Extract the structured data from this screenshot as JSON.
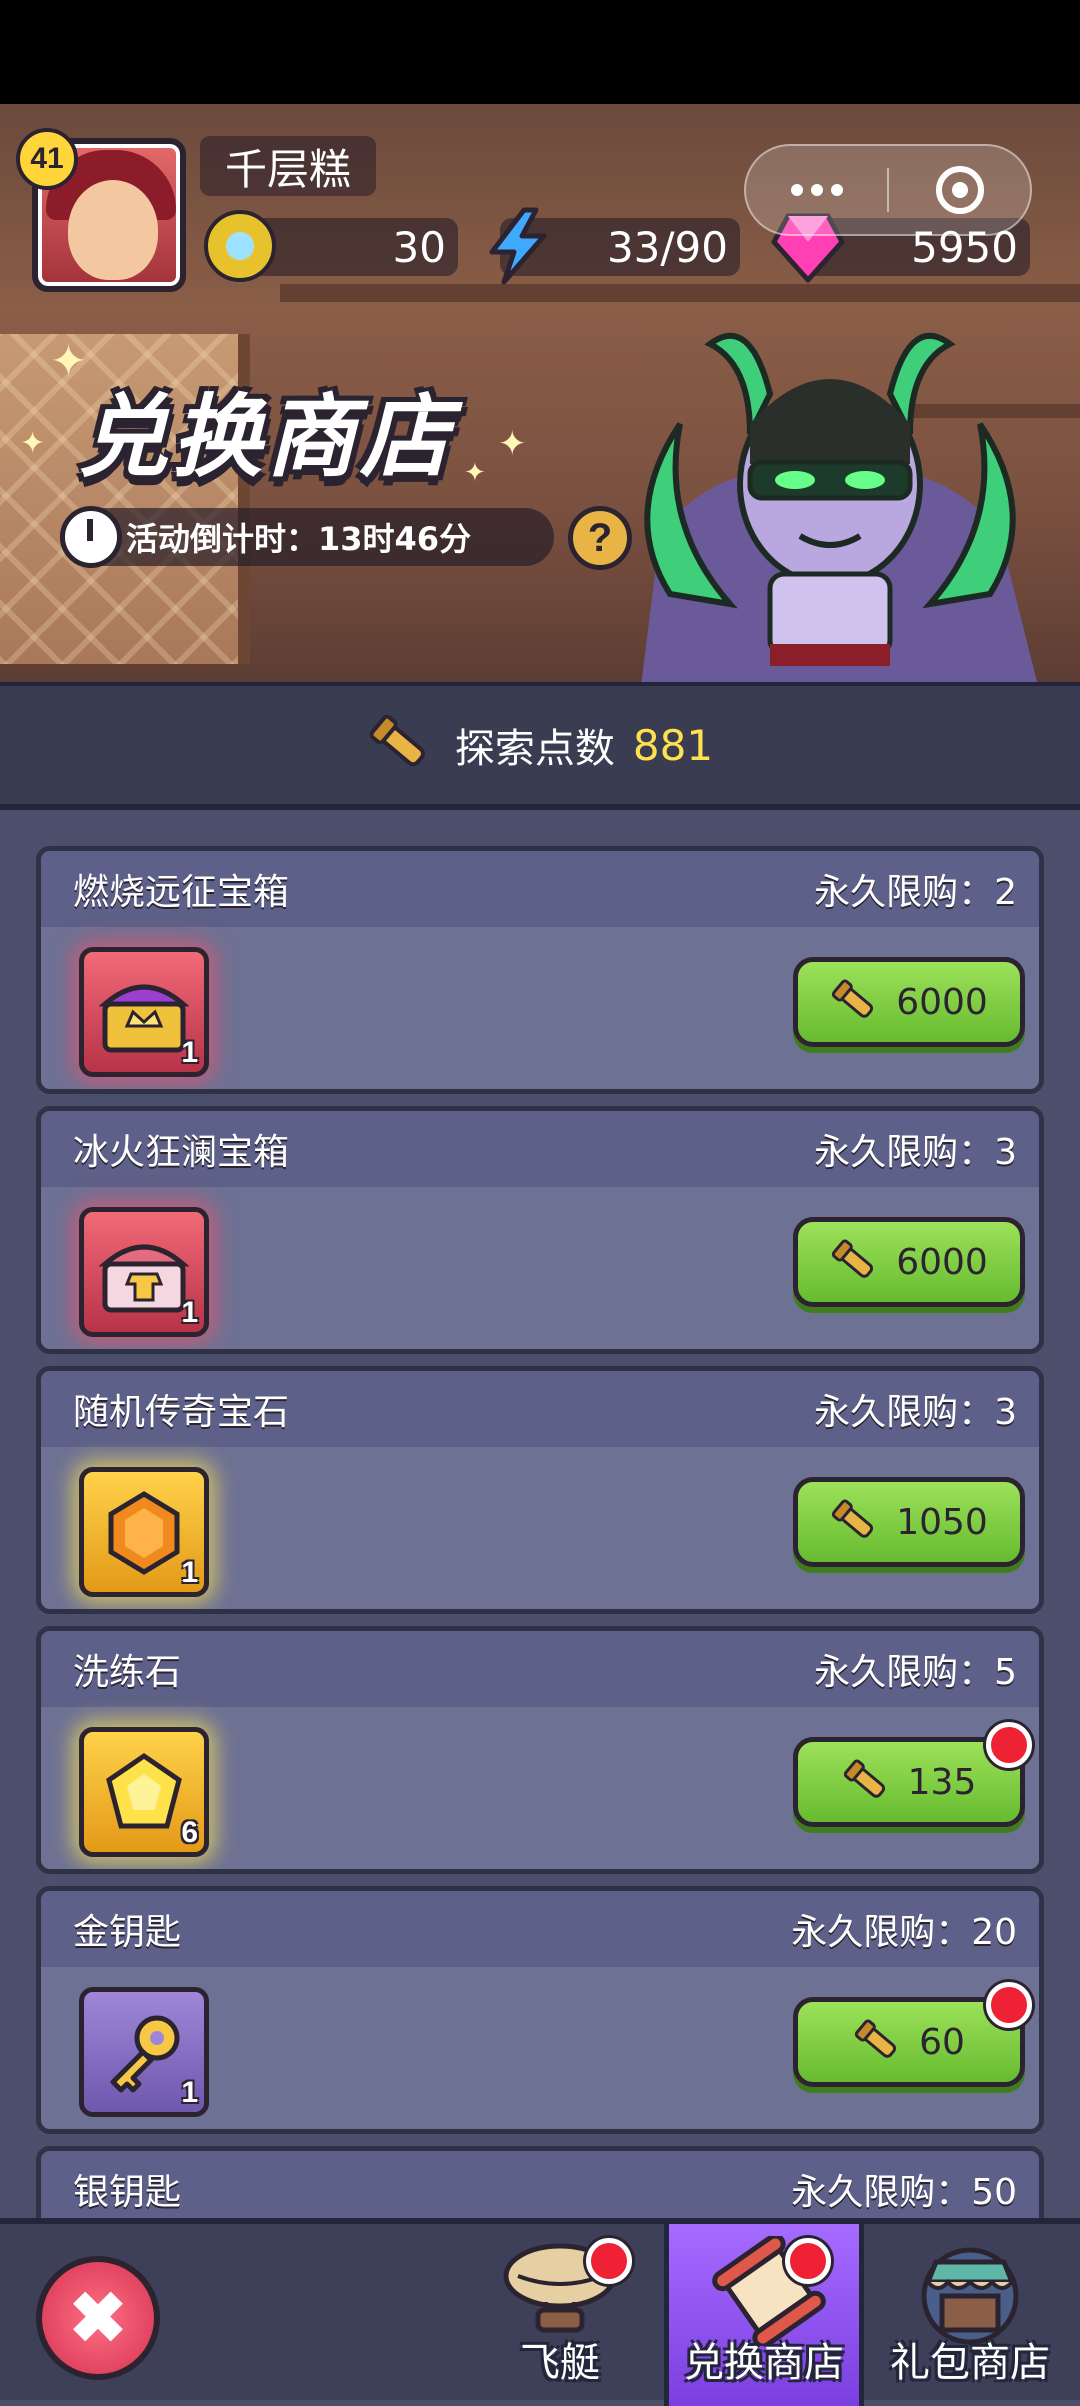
{
  "player": {
    "level": "41",
    "name": "千层糕"
  },
  "resources": {
    "coins": "30",
    "energy": "33/90",
    "gems": "5950"
  },
  "shop": {
    "title": "兑换商店",
    "countdown": "活动倒计时：13时46分",
    "help": "?"
  },
  "points": {
    "label": "探索点数",
    "value": "881"
  },
  "items": [
    {
      "name": "燃烧远征宝箱",
      "limit": "永久限购：2",
      "qty": "1",
      "price": "6000",
      "icon": "chest-crown-icon"
    },
    {
      "name": "冰火狂澜宝箱",
      "limit": "永久限购：3",
      "qty": "1",
      "price": "6000",
      "icon": "chest-armor-icon"
    },
    {
      "name": "随机传奇宝石",
      "limit": "永久限购：3",
      "qty": "1",
      "price": "1050",
      "icon": "orange-gem-icon"
    },
    {
      "name": "洗练石",
      "limit": "永久限购：5",
      "qty": "6",
      "price": "135",
      "icon": "yellow-stone-icon"
    },
    {
      "name": "金钥匙",
      "limit": "永久限购：20",
      "qty": "1",
      "price": "60",
      "icon": "gold-key-icon"
    },
    {
      "name": "银钥匙",
      "limit": "永久限购：50"
    }
  ],
  "nav": {
    "airship": "飞艇",
    "exchange": "兑换商店",
    "gift": "礼包商店",
    "close": "✖"
  },
  "colors": {
    "accent": "#7b3fe0",
    "buy": "#67bb30",
    "points": "#ffe04d",
    "badge": "#ef2135"
  }
}
